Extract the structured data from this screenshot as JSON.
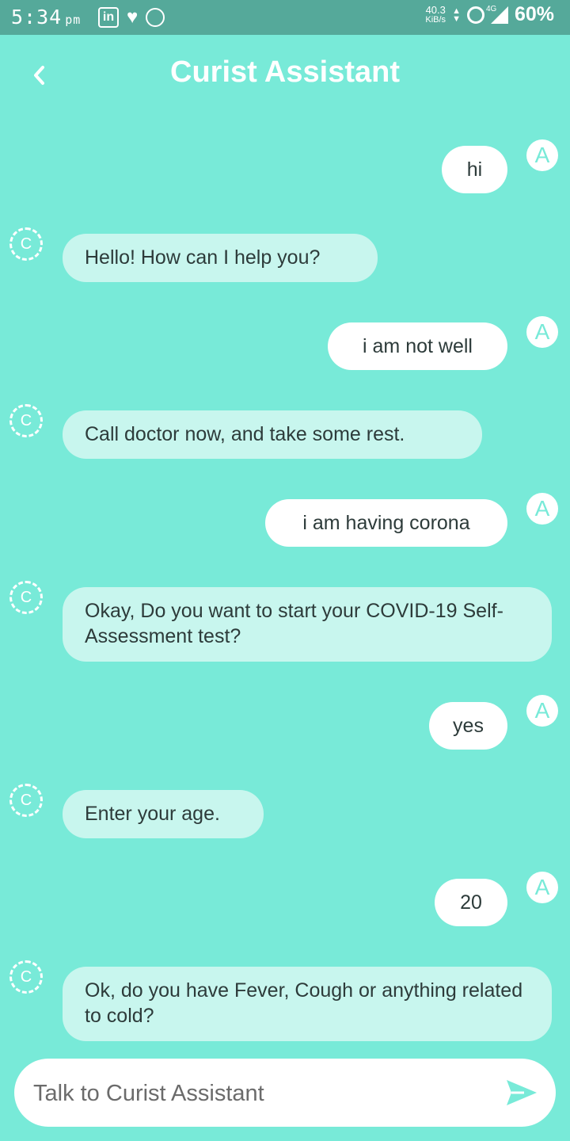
{
  "status_bar": {
    "time": "5:34",
    "ampm": "pm",
    "net_speed": "40.3",
    "net_unit": "KiB/s",
    "network": "4G",
    "battery": "60%",
    "icons": [
      "linkedin-icon",
      "heart-icon",
      "app-icon",
      "alarm-icon",
      "signal-icon"
    ]
  },
  "header": {
    "title": "Curist Assistant",
    "back_icon": "chevron-left-icon"
  },
  "avatars": {
    "user": "A",
    "bot": "C"
  },
  "messages": [
    {
      "from": "user",
      "text": "hi"
    },
    {
      "from": "bot",
      "text": "Hello! How can I help you?"
    },
    {
      "from": "user",
      "text": "i am not well"
    },
    {
      "from": "bot",
      "text": "Call doctor now, and take some rest."
    },
    {
      "from": "user",
      "text": "i am having corona"
    },
    {
      "from": "bot",
      "text": "Okay, Do you want to start your COVID-19 Self-Assessment test?"
    },
    {
      "from": "user",
      "text": "yes"
    },
    {
      "from": "bot",
      "text": "Enter your age."
    },
    {
      "from": "user",
      "text": "20"
    },
    {
      "from": "bot",
      "text": "Ok, do you have Fever, Cough or anything related to cold?"
    }
  ],
  "composer": {
    "placeholder": "Talk to Curist Assistant",
    "send_icon": "send-icon"
  },
  "colors": {
    "background": "#78EAD8",
    "status_bar": "#55A99A",
    "bot_bubble": "#C8F6EE",
    "user_bubble": "#FFFFFF"
  }
}
